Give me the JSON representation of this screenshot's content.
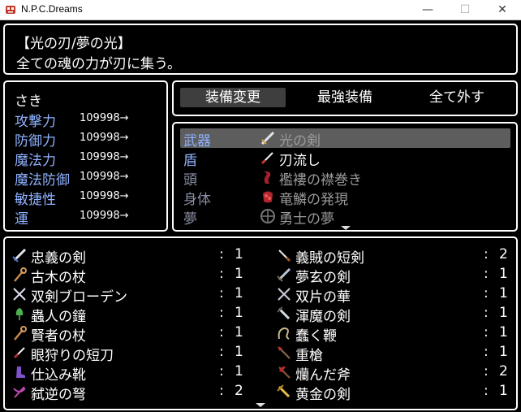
{
  "window": {
    "title": "N.P.C.Dreams",
    "buttons": [
      "—",
      "☐",
      "✕"
    ]
  },
  "help": {
    "line1": "【光の刃/夢の光】",
    "line2": "全ての魂の力が刃に集う。"
  },
  "status": {
    "name": "さき",
    "params": [
      {
        "label": "攻撃力",
        "value": "109998→"
      },
      {
        "label": "防御力",
        "value": "109998→"
      },
      {
        "label": "魔法力",
        "value": "109998→"
      },
      {
        "label": "魔法防御",
        "value": "109998→"
      },
      {
        "label": "敏捷性",
        "value": "109998→"
      },
      {
        "label": "運",
        "value": "109998→"
      }
    ]
  },
  "commands": [
    "装備変更",
    "最強装備",
    "全て外す"
  ],
  "slots": [
    {
      "slot": "武器",
      "item": "光の剣",
      "icon": "sword-icon",
      "selected": true
    },
    {
      "slot": "盾",
      "item": "刃流し",
      "icon": "dagger-icon",
      "selected": false
    },
    {
      "slot": "頭",
      "item": "襤褸の襟巻き",
      "icon": "scarf-icon",
      "selected": false
    },
    {
      "slot": "身体",
      "item": "竜鱗の発現",
      "icon": "dragon-scale-icon",
      "selected": false
    },
    {
      "slot": "夢",
      "item": "勇士の夢",
      "icon": "emblem-icon",
      "selected": false
    }
  ],
  "items_left": [
    {
      "name": "忠義の剣",
      "colon": ":",
      "count": "1",
      "icon": "sword-icon"
    },
    {
      "name": "古木の杖",
      "colon": ":",
      "count": "1",
      "icon": "staff-icon"
    },
    {
      "name": "双剣ブローデン",
      "colon": ":",
      "count": "1",
      "icon": "crossed-swords-icon"
    },
    {
      "name": "蟲人の鐘",
      "colon": ":",
      "count": "1",
      "icon": "bell-icon"
    },
    {
      "name": "賢者の杖",
      "colon": ":",
      "count": "1",
      "icon": "staff-icon"
    },
    {
      "name": "眼狩りの短刀",
      "colon": ":",
      "count": "1",
      "icon": "dagger-icon"
    },
    {
      "name": "仕込み靴",
      "colon": ":",
      "count": "1",
      "icon": "boot-icon"
    },
    {
      "name": "弑逆の弩",
      "colon": ":",
      "count": "2",
      "icon": "crossbow-icon"
    }
  ],
  "items_right": [
    {
      "name": "義賊の短剣",
      "colon": ":",
      "count": "2",
      "icon": "dagger-icon"
    },
    {
      "name": "夢玄の剣",
      "colon": ":",
      "count": "1",
      "icon": "sword-icon"
    },
    {
      "name": "双片の華",
      "colon": ":",
      "count": "1",
      "icon": "crossed-swords-icon"
    },
    {
      "name": "渾魔の剣",
      "colon": ":",
      "count": "1",
      "icon": "sword-icon"
    },
    {
      "name": "蠢く鞭",
      "colon": ":",
      "count": "1",
      "icon": "whip-icon"
    },
    {
      "name": "重槍",
      "colon": ":",
      "count": "1",
      "icon": "spear-icon"
    },
    {
      "name": "爤んだ斧",
      "colon": ":",
      "count": "2",
      "icon": "axe-icon"
    },
    {
      "name": "黄金の剣",
      "colon": ":",
      "count": "1",
      "icon": "gold-sword-icon"
    }
  ],
  "colors": {
    "system": "#8fb2ff",
    "disabled": "#9a9a9a",
    "text": "#ffffff",
    "selection": "#5d5d5d"
  }
}
